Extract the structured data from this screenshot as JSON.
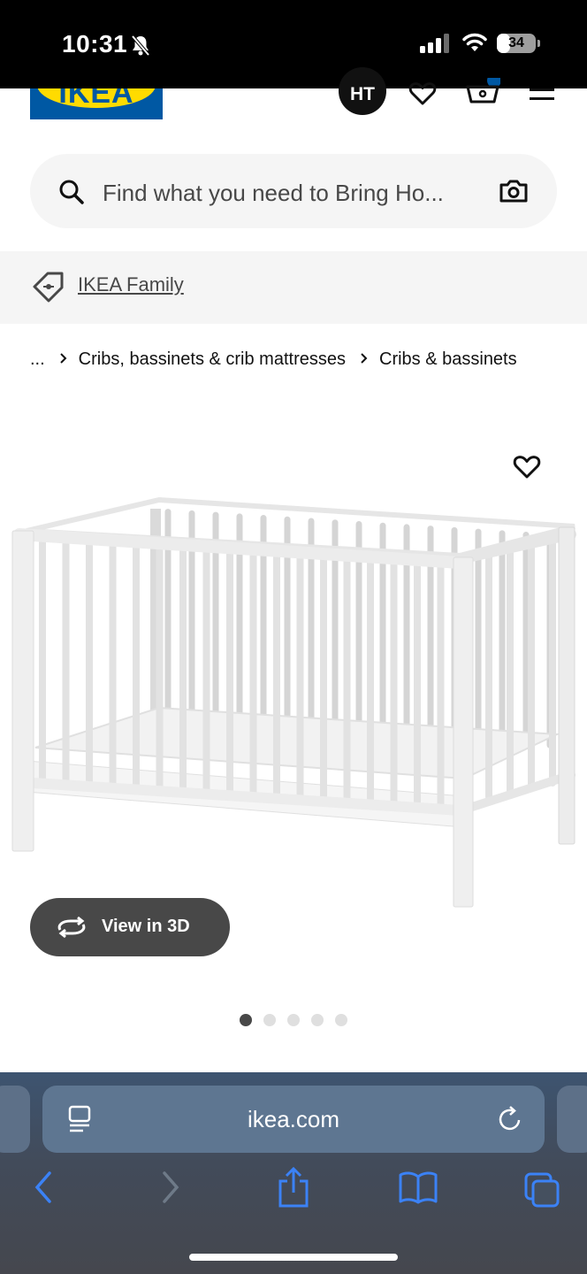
{
  "status_bar": {
    "time": "10:31",
    "battery": "34",
    "battery_level": 0.34,
    "icons": [
      "bell-slash-icon",
      "signal-icon",
      "wifi-icon",
      "battery-icon"
    ]
  },
  "header": {
    "logo_text": "IKEA",
    "avatar_initials": "HT",
    "icons": [
      "heart-icon",
      "basket-icon",
      "menu-icon"
    ]
  },
  "search": {
    "placeholder": "Find what you need to Bring Ho...",
    "icons": [
      "search-icon",
      "camera-icon"
    ]
  },
  "family_bar": {
    "label": "IKEA Family",
    "icon": "tag-icon"
  },
  "breadcrumb": {
    "ellipsis": "...",
    "items": [
      "Cribs, bassinets & crib mattresses",
      "Cribs & bassinets"
    ],
    "separator_icon": "chevron-right-icon"
  },
  "product": {
    "image": "white-crib-image",
    "wishlist_icon": "heart-icon",
    "view3d_label": "View in 3D",
    "view3d_icon": "rotate-icon",
    "gallery_dots": 5,
    "active_dot": 1
  },
  "browser": {
    "url": "ikea.com",
    "icons": [
      "reader-icon",
      "reload-icon",
      "back-icon",
      "forward-icon",
      "share-icon",
      "bookmarks-icon",
      "tabs-icon"
    ]
  },
  "colors": {
    "ikea_blue": "#0058a3",
    "ikea_yellow": "#ffdb00",
    "dark_gray": "#484848",
    "safari_blue": "#3b82f6"
  }
}
